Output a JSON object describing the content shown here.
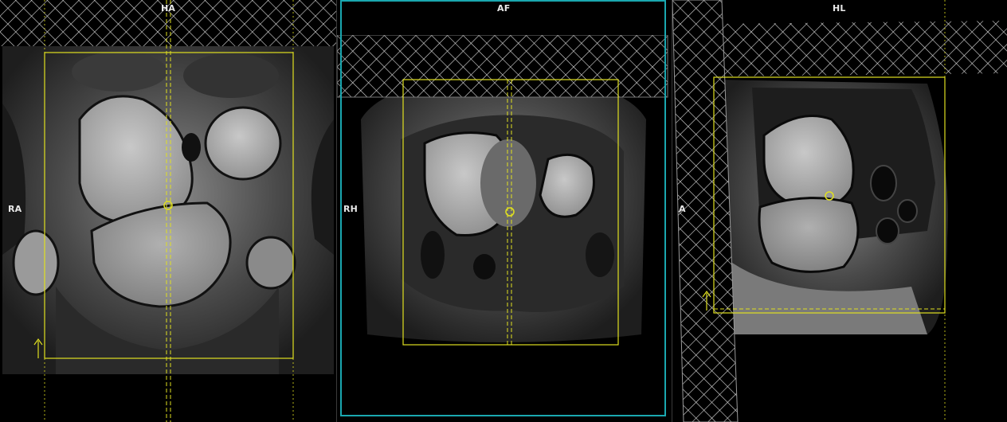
{
  "viewports": {
    "coronal": {
      "top_label": "HA",
      "left_label": "RA",
      "active": false
    },
    "axial": {
      "top_label": "AF",
      "left_label": "RH",
      "active": true
    },
    "sagittal": {
      "top_label": "HL",
      "left_label": "A",
      "active": false
    }
  },
  "colors": {
    "planning_box": "#e0e020",
    "active_border": "#1aa7b0",
    "sat_band_hatch": "#ffffff",
    "label_text": "#e8e8e8"
  },
  "icons": {
    "direction_arrow": "up-arrow-icon",
    "center_marker": "circle-marker-icon"
  }
}
